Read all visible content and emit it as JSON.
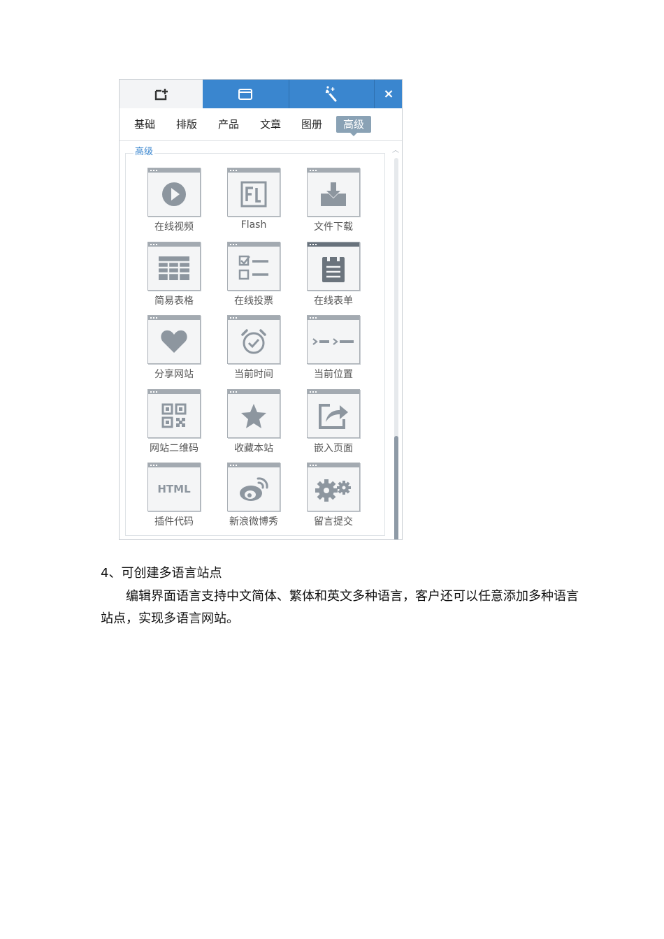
{
  "panel": {
    "toolbar": {
      "add_icon": "add-module-icon",
      "window_icon": "window-icon",
      "wand_icon": "magic-wand-icon",
      "close_label": "×"
    },
    "tabs": [
      {
        "label": "基础"
      },
      {
        "label": "排版"
      },
      {
        "label": "产品"
      },
      {
        "label": "文章"
      },
      {
        "label": "图册"
      },
      {
        "label": "高级",
        "active": true
      }
    ],
    "section_title": "高级",
    "items": [
      {
        "label": "在线视频",
        "icon": "play-icon"
      },
      {
        "label": "Flash",
        "icon": "flash-icon"
      },
      {
        "label": "文件下载",
        "icon": "download-icon"
      },
      {
        "label": "简易表格",
        "icon": "table-icon"
      },
      {
        "label": "在线投票",
        "icon": "vote-icon"
      },
      {
        "label": "在线表单",
        "icon": "form-icon",
        "selected": true
      },
      {
        "label": "分享网站",
        "icon": "heart-icon"
      },
      {
        "label": "当前时间",
        "icon": "clock-icon"
      },
      {
        "label": "当前位置",
        "icon": "breadcrumb-icon"
      },
      {
        "label": "网站二维码",
        "icon": "qr-code-icon"
      },
      {
        "label": "收藏本站",
        "icon": "star-icon"
      },
      {
        "label": "嵌入页面",
        "icon": "share-icon"
      },
      {
        "label": "插件代码",
        "icon": "html-icon",
        "icon_text": "HTML"
      },
      {
        "label": "新浪微博秀",
        "icon": "weibo-icon"
      },
      {
        "label": "留言提交",
        "icon": "gears-icon"
      }
    ]
  },
  "doc": {
    "heading": "4、可创建多语言站点",
    "paragraph": "编辑界面语言支持中文简体、繁体和英文多种语言，客户还可以任意添加多种语言站点，实现多语言网站。"
  },
  "colors": {
    "accent": "#3a86cf",
    "icon": "#8d969f",
    "icon_selected": "#6b747d"
  }
}
